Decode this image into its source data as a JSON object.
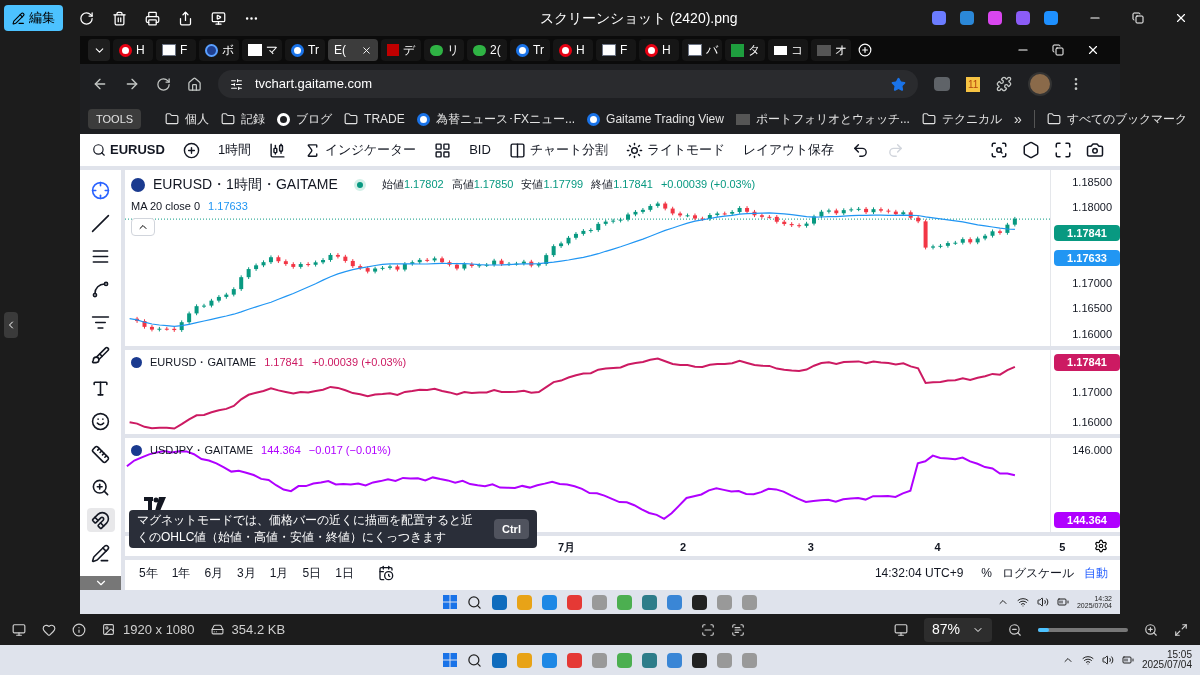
{
  "viewer": {
    "edit_label": "編集",
    "title": "スクリーンショット (2420).png",
    "dimensions": "1920 x 1080",
    "file_size": "354.2 KB",
    "zoom": "87%",
    "zoom_slider": {
      "level": 0.12
    }
  },
  "browser": {
    "tabs": [
      {
        "label": "H",
        "kind": "red_ring",
        "selected": false
      },
      {
        "label": "F",
        "kind": "gaitame",
        "selected": false
      },
      {
        "label": "ボ",
        "kind": "blue_circle",
        "selected": false
      },
      {
        "label": "マ",
        "kind": "my",
        "selected": false
      },
      {
        "label": "Tr",
        "kind": "google",
        "selected": false
      },
      {
        "label": "E(",
        "kind": "plain",
        "selected": true
      },
      {
        "label": "デ",
        "kind": "rakuten",
        "selected": false
      },
      {
        "label": "リ",
        "kind": "green",
        "selected": false
      },
      {
        "label": "2(",
        "kind": "green",
        "selected": false
      },
      {
        "label": "Tr",
        "kind": "google",
        "selected": false
      },
      {
        "label": "H",
        "kind": "red_ring",
        "selected": false
      },
      {
        "label": "F",
        "kind": "gaitame",
        "selected": false
      },
      {
        "label": "H",
        "kind": "red_ring",
        "selected": false
      },
      {
        "label": "バ",
        "kind": "gaitame",
        "selected": false
      },
      {
        "label": "タ",
        "kind": "plus",
        "selected": false
      },
      {
        "label": "コ",
        "kind": "tradingview",
        "selected": false
      },
      {
        "label": "オ",
        "kind": "investing",
        "selected": false
      }
    ],
    "address": "tvchart.gaitame.com",
    "bookmarked": true,
    "extension_badge": "11",
    "bookmarks": [
      {
        "kind": "pill",
        "label": "TOOLS"
      },
      {
        "kind": "apps"
      },
      {
        "kind": "folder",
        "label": "個人"
      },
      {
        "kind": "folder",
        "label": "記録"
      },
      {
        "kind": "ring",
        "label": "ブログ"
      },
      {
        "kind": "folder",
        "label": "TRADE"
      },
      {
        "kind": "google",
        "label": "為替ニュース･FXニュー..."
      },
      {
        "kind": "google",
        "label": "Gaitame Trading View"
      },
      {
        "kind": "investing",
        "label": "ポートフォリオとウォッチ..."
      },
      {
        "kind": "folder",
        "label": "テクニカル"
      }
    ],
    "overflow": "»",
    "all_bookmarks": "すべてのブックマーク"
  },
  "chart": {
    "toolbar": [
      {
        "kind": "search",
        "label": "EURUSD"
      },
      {
        "kind": "add"
      },
      {
        "kind": "text",
        "label": "1時間"
      },
      {
        "kind": "candles"
      },
      {
        "kind": "fx",
        "label": "インジケーター"
      },
      {
        "kind": "grid"
      },
      {
        "kind": "text",
        "label": "BID"
      },
      {
        "kind": "split",
        "label": "チャート分割"
      },
      {
        "kind": "sun",
        "label": "ライトモード"
      },
      {
        "kind": "text",
        "label": "レイアウト保存"
      },
      {
        "kind": "undo",
        "disabled": false
      },
      {
        "kind": "redo",
        "disabled": true
      }
    ],
    "drawing_tools": [
      {
        "kind": "crosshair",
        "selected": true
      },
      {
        "kind": "line",
        "selected": false
      },
      {
        "kind": "channels",
        "selected": false
      },
      {
        "kind": "pattern",
        "selected": false
      },
      {
        "kind": "fib",
        "selected": false
      },
      {
        "kind": "brush",
        "selected": false
      },
      {
        "kind": "text",
        "selected": false
      },
      {
        "kind": "emoji",
        "selected": false
      },
      {
        "kind": "ruler",
        "selected": false
      },
      {
        "kind": "zoom",
        "selected": false
      },
      {
        "kind": "magnet",
        "selected": true
      },
      {
        "kind": "lock",
        "selected": false
      }
    ],
    "main_pane": {
      "symbol": "EURUSD・1時間・GAITAME",
      "ohlc": [
        {
          "name": "始値",
          "value": "1.17802"
        },
        {
          "name": "高値",
          "value": "1.17850"
        },
        {
          "name": "安値",
          "value": "1.17799"
        },
        {
          "name": "終値",
          "value": "1.17841"
        }
      ],
      "change": "+0.00039 (+0.03%)",
      "indicator": "MA 20 close 0",
      "indicator_value": "1.17633",
      "axis": [
        {
          "kind": "tick",
          "label": "1.18500"
        },
        {
          "kind": "tick",
          "label": "1.18000"
        },
        {
          "kind": "price",
          "label": "1.17841",
          "color": "#089981"
        },
        {
          "kind": "price",
          "label": "1.17633",
          "color": "#2196f3"
        },
        {
          "kind": "tick",
          "label": "1.17000"
        },
        {
          "kind": "tick",
          "label": "1.16500"
        },
        {
          "kind": "tick",
          "label": "1.16000"
        }
      ]
    },
    "compare_panes": [
      {
        "symbol": "EURUSD・GAITAME",
        "value": "1.17841",
        "change": "+0.00039 (+0.03%)",
        "color": "#cc1a62",
        "kind": "eurusd",
        "axis": [
          {
            "kind": "price",
            "label": "1.17841",
            "color": "#cc1a62"
          },
          {
            "kind": "tick",
            "label": "1.17000"
          },
          {
            "kind": "tick",
            "label": "1.16000"
          }
        ]
      },
      {
        "symbol": "USDJPY・GAITAME",
        "value": "144.364",
        "change": "−0.017 (−0.01%)",
        "color": "#b000ff",
        "kind": "usdjpy",
        "axis": [
          {
            "kind": "tick",
            "label": "146.000"
          },
          {
            "kind": "price",
            "label": "144.364",
            "color": "#b000ff"
          }
        ]
      }
    ],
    "time_labels": [
      "7月",
      "2",
      "3",
      "4",
      "5"
    ],
    "tooltip": {
      "text": "マグネットモードでは、価格バーの近くに描画を配置すると近くのOHLC値（始値・高値・安値・終値）にくっつきます",
      "shortcut": "Ctrl"
    },
    "ranges": [
      "5年",
      "1年",
      "6月",
      "3月",
      "1月",
      "5日",
      "1日"
    ],
    "clock": "14:32:04 UTC+9",
    "percent": "%",
    "log_scale": "ログスケール",
    "auto": "自動",
    "auto_on": true
  },
  "inner_taskbar": {
    "time": "14:32",
    "date": "2025/07/04"
  },
  "outer_taskbar": {
    "time": "15:05",
    "date": "2025/07/04"
  }
}
